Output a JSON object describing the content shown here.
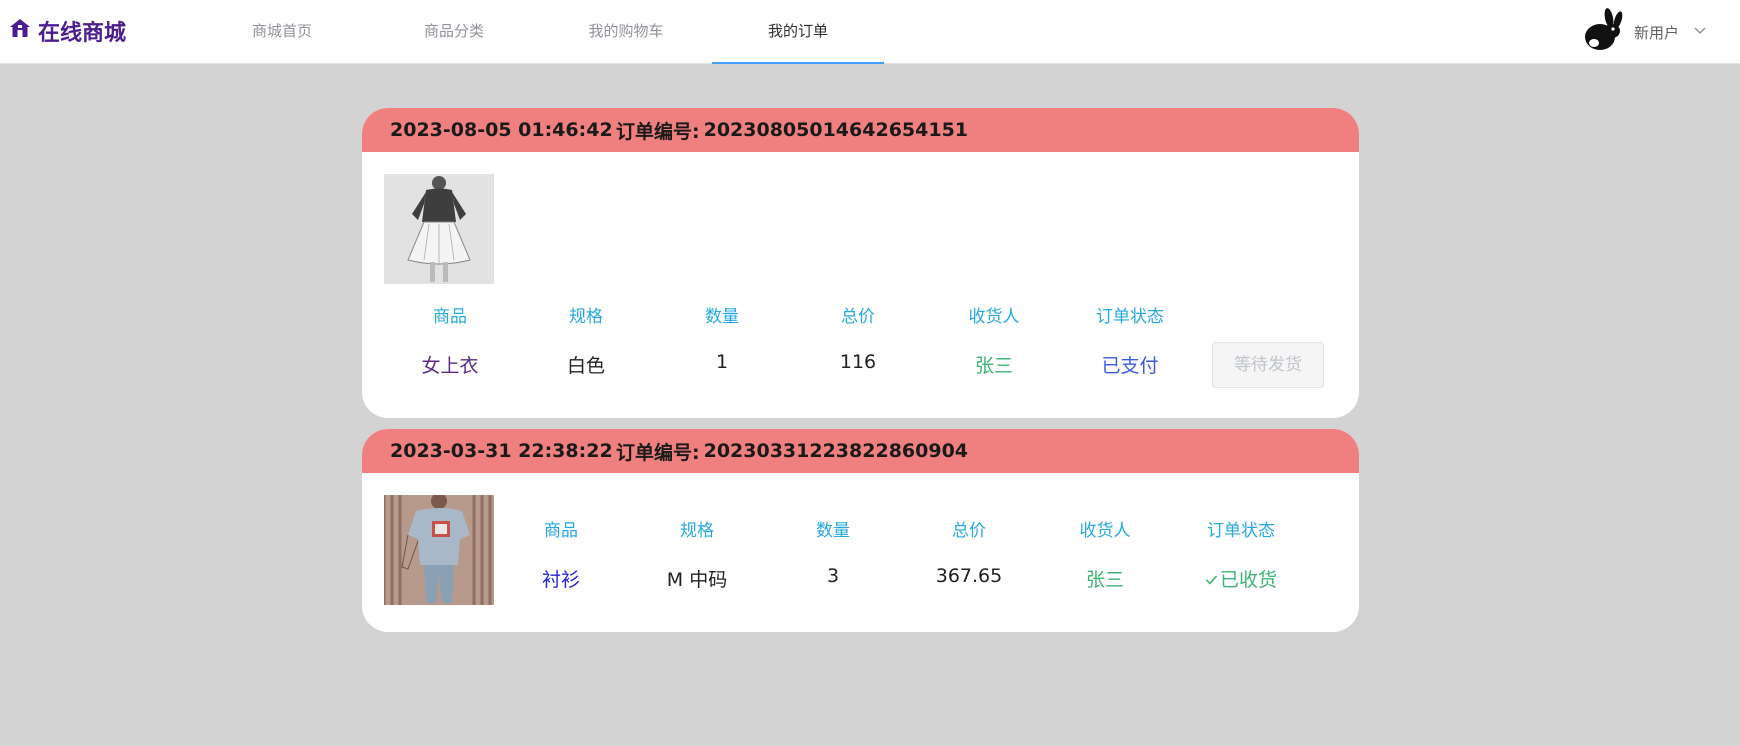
{
  "header": {
    "brand": "在线商城",
    "nav": [
      "商城首页",
      "商品分类",
      "我的购物车",
      "我的订单"
    ],
    "active_tab": "我的订单",
    "user_name": "新用户"
  },
  "columns": [
    "商品",
    "规格",
    "数量",
    "总价",
    "收货人",
    "订单状态"
  ],
  "orders": [
    {
      "time": "2023-08-05 01:46:42",
      "no_label": "订单编号:",
      "no": "20230805014642654151",
      "product": "女上衣",
      "spec": "白色",
      "qty": "1",
      "total": "116",
      "receiver": "张三",
      "status": "已支付",
      "action": "等待发货"
    },
    {
      "time": "2023-03-31 22:38:22",
      "no_label": "订单编号:",
      "no": "20230331223822860904",
      "product": "衬衫",
      "spec": "M 中码",
      "qty": "3",
      "total": "367.65",
      "receiver": "张三",
      "status": "已收货"
    }
  ],
  "colors": {
    "brand": "#4b1d8f",
    "order_header": "#f08080",
    "column_header": "#26a9e0",
    "active_underline": "#409eff",
    "receiver": "#3cb371"
  },
  "icons": [
    "home-icon",
    "avatar-rabbit-icon",
    "chevron-down-icon",
    "check-icon"
  ]
}
